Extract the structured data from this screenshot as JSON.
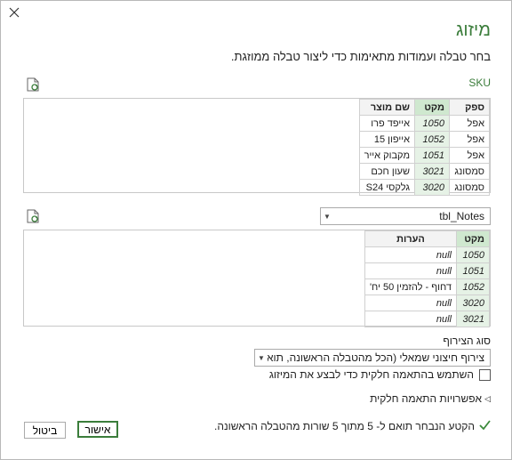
{
  "dialog": {
    "close_label": "✕",
    "title": "מיזוג",
    "subtitle": "בחר טבלה ועמודות מתאימות כדי ליצור טבלה ממוזגת."
  },
  "table1": {
    "name": "SKU",
    "headers": [
      "ספק",
      "מקט",
      "שם מוצר"
    ],
    "rows": [
      [
        "אפל",
        "1050",
        "אייפד פרו"
      ],
      [
        "אפל",
        "1052",
        "אייפון 15"
      ],
      [
        "אפל",
        "1051",
        "מקבוק אייר"
      ],
      [
        "סמסונג",
        "3021",
        "שעון חכם"
      ],
      [
        "סמסונג",
        "3020",
        "גלקסי S24"
      ]
    ]
  },
  "table2": {
    "selected_table": "tbl_Notes",
    "headers": [
      "מקט",
      "הערות"
    ],
    "rows": [
      [
        "1050",
        "null"
      ],
      [
        "1051",
        "null"
      ],
      [
        "1052",
        "דחוף - להזמין 50 יח'"
      ],
      [
        "3020",
        "null"
      ],
      [
        "3021",
        "null"
      ]
    ]
  },
  "join": {
    "label": "סוג הצירוף",
    "selected": "צירוף חיצוני שמאלי (הכל מהטבלה הראשונה, תואמים מ...",
    "fuzzy_checkbox_label": "השתמש בהתאמה חלקית כדי לבצע את המיזוג",
    "fuzzy_checked": false,
    "fuzzy_options_label": "אפשרויות התאמה חלקית"
  },
  "status": {
    "text": "הקטע הנבחר תואם ל- 5 מתוך 5 שורות מהטבלה הראשונה.",
    "color": "#3b8a3b"
  },
  "buttons": {
    "ok": "אישור",
    "cancel": "ביטול"
  }
}
